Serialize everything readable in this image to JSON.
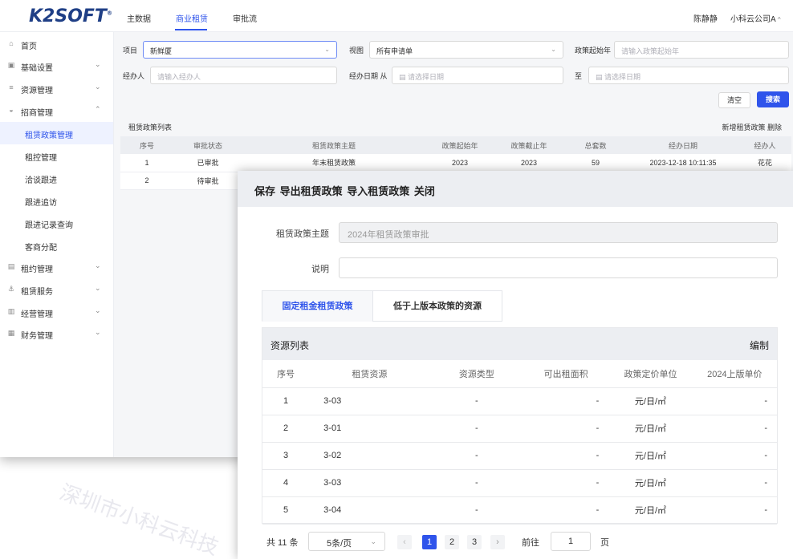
{
  "topbar": {
    "logo": "K2SOFT",
    "logo_mark": "®",
    "tabs": [
      "主数据",
      "商业租赁",
      "审批流"
    ],
    "active_tab_index": 1,
    "user": "陈静静",
    "company": "小科云公司A",
    "company_chevron": "^"
  },
  "sidebar": {
    "items": [
      {
        "label": "首页",
        "icon": "home-icon",
        "glyph": "⌂"
      },
      {
        "label": "基础设置",
        "icon": "settings-icon",
        "glyph": "▣",
        "chevron": "⌄"
      },
      {
        "label": "资源管理",
        "icon": "resource-icon",
        "glyph": "≡",
        "chevron": "⌄"
      },
      {
        "label": "招商管理",
        "icon": "investment-icon",
        "glyph": "◒",
        "chevron": "⌃"
      },
      {
        "label": "租赁政策管理",
        "sub": true,
        "active": true
      },
      {
        "label": "租控管理",
        "sub": true
      },
      {
        "label": "洽谈跟进",
        "sub": true
      },
      {
        "label": "跟进追访",
        "sub": true
      },
      {
        "label": "跟进记录查询",
        "sub": true
      },
      {
        "label": "客商分配",
        "sub": true
      },
      {
        "label": "租约管理",
        "icon": "contract-icon",
        "glyph": "▤",
        "chevron": "⌄"
      },
      {
        "label": "租赁服务",
        "icon": "service-icon",
        "glyph": "⚓",
        "chevron": "⌄"
      },
      {
        "label": "经营管理",
        "icon": "operation-icon",
        "glyph": "▥",
        "chevron": "⌄"
      },
      {
        "label": "财务管理",
        "icon": "finance-icon",
        "glyph": "▦",
        "chevron": "⌄"
      }
    ]
  },
  "filters": {
    "project_label": "项目",
    "project_value": "新鲜厦",
    "view_label": "视图",
    "view_value": "所有申请单",
    "start_year_label": "政策起始年",
    "start_year_placeholder": "请输入政策起始年",
    "handler_label": "经办人",
    "handler_placeholder": "请输入经办人",
    "date_from_label": "经办日期 从",
    "date_from_placeholder": "请选择日期",
    "date_to_label": "至",
    "date_to_placeholder": "请选择日期",
    "clear_button": "清空",
    "search_button": "搜索",
    "select_arrow": "⌄",
    "calendar_glyph": "▤"
  },
  "policy_list": {
    "title": "租赁政策列表",
    "actions": "新增租赁政策  删除",
    "columns": [
      "序号",
      "审批状态",
      "租赁政策主题",
      "政策起始年",
      "政策截止年",
      "总套数",
      "经办日期",
      "经办人"
    ],
    "rows": [
      [
        "1",
        "已审批",
        "年末租赁政策",
        "2023",
        "2023",
        "59",
        "2023-12-18 10:11:35",
        "花花"
      ],
      [
        "2",
        "待审批",
        "",
        "",
        "",
        "",
        "",
        ""
      ]
    ]
  },
  "modal": {
    "header": "保存  导出租赁政策  导入租赁政策  关闭",
    "subject_label": "租赁政策主题",
    "subject_value": "2024年租赁政策审批",
    "desc_label": "说明",
    "desc_value": "",
    "tabs": [
      "固定租金租赁政策",
      "低于上版本政策的资源"
    ],
    "active_tab_index": 0,
    "resource_list": {
      "title": "资源列表",
      "edit": "编制",
      "columns": [
        "序号",
        "租赁资源",
        "资源类型",
        "可出租面积",
        "政策定价单位",
        "2024上版单价"
      ],
      "rows": [
        [
          "1",
          "3-03",
          "-",
          "-",
          "元/日/㎡",
          "-"
        ],
        [
          "2",
          "3-01",
          "-",
          "-",
          "元/日/㎡",
          "-"
        ],
        [
          "3",
          "3-02",
          "-",
          "-",
          "元/日/㎡",
          "-"
        ],
        [
          "4",
          "3-03",
          "-",
          "-",
          "元/日/㎡",
          "-"
        ],
        [
          "5",
          "3-04",
          "-",
          "-",
          "元/日/㎡",
          "-"
        ]
      ]
    },
    "pagination": {
      "total": "共 11 条",
      "page_size": "5条/页",
      "prev": "‹",
      "pages": [
        "1",
        "2",
        "3"
      ],
      "current": "1",
      "next": "›",
      "goto_label": "前往",
      "goto_value": "1",
      "page_suffix": "页"
    }
  },
  "watermark": "深圳市小科云科技"
}
